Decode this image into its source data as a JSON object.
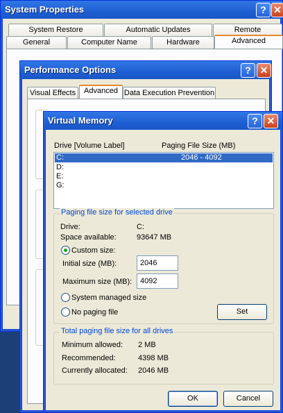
{
  "system_properties": {
    "title": "System Properties",
    "tabs_back": [
      "System Restore",
      "Automatic Updates",
      "Remote"
    ],
    "tabs_front": [
      "General",
      "Computer Name",
      "Hardware",
      "Advanced"
    ]
  },
  "performance_options": {
    "title": "Performance Options",
    "tabs": [
      "Visual Effects",
      "Advanced",
      "Data Execution Prevention"
    ]
  },
  "virtual_memory": {
    "title": "Virtual Memory",
    "columns": {
      "drive": "Drive  [Volume Label]",
      "size": "Paging File Size (MB)"
    },
    "drives": [
      {
        "drive": "C:",
        "size": "2046 - 4092",
        "selected": true
      },
      {
        "drive": "D:",
        "size": ""
      },
      {
        "drive": "E:",
        "size": ""
      },
      {
        "drive": "G:",
        "size": ""
      }
    ],
    "selected_group": {
      "label": "Paging file size for selected drive",
      "drive_label": "Drive:",
      "drive_value": "C:",
      "space_label": "Space available:",
      "space_value": "93647 MB",
      "custom_size": "Custom size:",
      "initial_label": "Initial size (MB):",
      "initial_value": "2046",
      "maximum_label": "Maximum size (MB):",
      "maximum_value": "4092",
      "system_managed": "System managed size",
      "no_paging": "No paging file",
      "selected_option": "custom",
      "set_button": "Set"
    },
    "total_group": {
      "label": "Total paging file size for all drives",
      "min_label": "Minimum allowed:",
      "min_value": "2 MB",
      "rec_label": "Recommended:",
      "rec_value": "4398 MB",
      "alloc_label": "Currently allocated:",
      "alloc_value": "2046 MB"
    },
    "ok_button": "OK",
    "cancel_button": "Cancel"
  },
  "title_buttons": {
    "help": "?",
    "close": "✕"
  }
}
